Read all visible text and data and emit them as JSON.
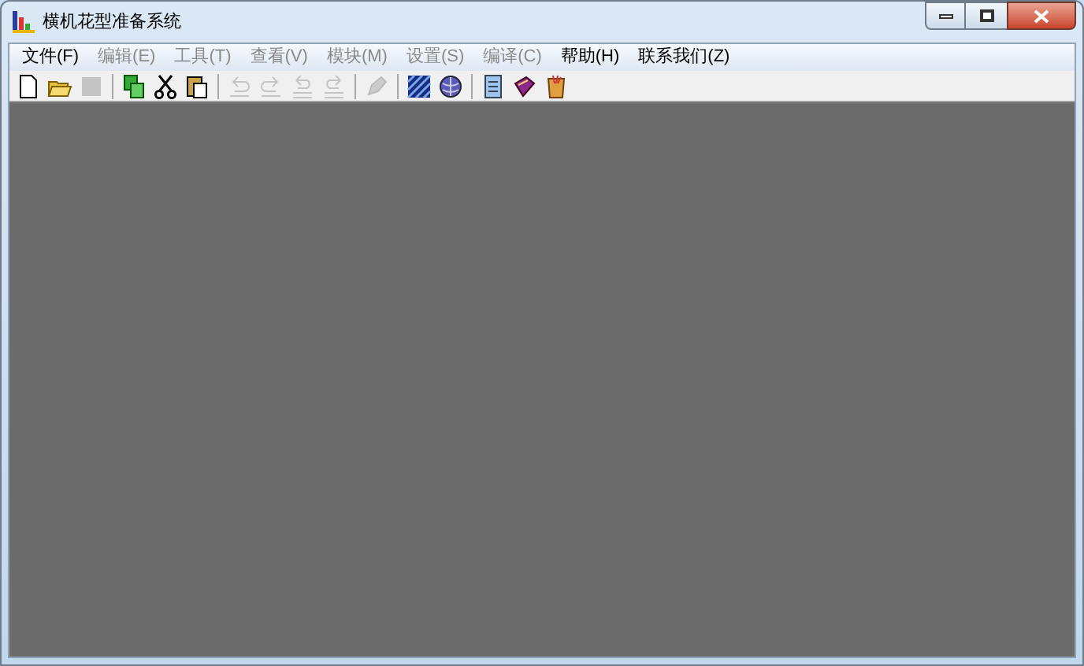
{
  "window": {
    "title": "横机花型准备系统"
  },
  "menu": [
    {
      "label": "文件(F)",
      "disabled": false
    },
    {
      "label": "编辑(E)",
      "disabled": true
    },
    {
      "label": "工具(T)",
      "disabled": true
    },
    {
      "label": "查看(V)",
      "disabled": true
    },
    {
      "label": "模块(M)",
      "disabled": true
    },
    {
      "label": "设置(S)",
      "disabled": true
    },
    {
      "label": "编译(C)",
      "disabled": true
    },
    {
      "label": "帮助(H)",
      "disabled": false
    },
    {
      "label": "联系我们(Z)",
      "disabled": false
    }
  ],
  "toolbar": [
    [
      {
        "disabled": false
      },
      {
        "disabled": false
      },
      {
        "disabled": true
      }
    ],
    [
      {
        "disabled": false
      },
      {
        "disabled": false
      },
      {
        "disabled": false
      }
    ],
    [
      {
        "disabled": true
      },
      {
        "disabled": true
      },
      {
        "disabled": true
      },
      {
        "disabled": true
      }
    ],
    [
      {
        "disabled": true
      }
    ],
    [
      {
        "disabled": false
      },
      {
        "disabled": false
      }
    ],
    [
      {
        "disabled": false
      },
      {
        "disabled": false
      },
      {
        "disabled": false
      }
    ]
  ]
}
